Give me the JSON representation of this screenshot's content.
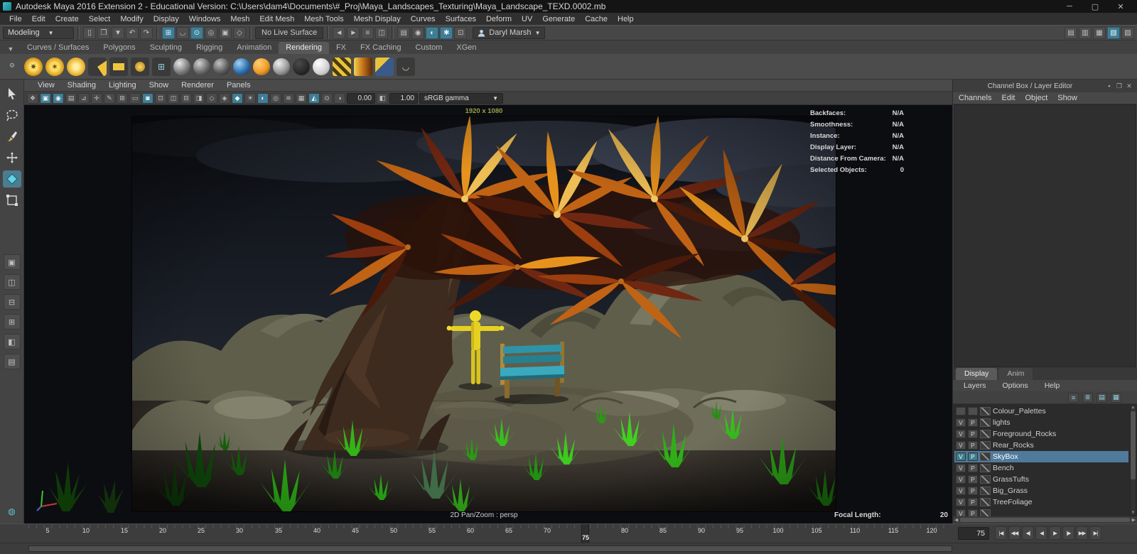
{
  "window": {
    "title": "Autodesk Maya 2016 Extension 2 - Educational Version: C:\\Users\\dam4\\Documents\\#_Proj\\Maya_Landscapes_Texturing\\Maya_Landscape_TEXD.0002.mb"
  },
  "menubar": {
    "items": [
      "File",
      "Edit",
      "Create",
      "Select",
      "Modify",
      "Display",
      "Windows",
      "Mesh",
      "Edit Mesh",
      "Mesh Tools",
      "Mesh Display",
      "Curves",
      "Surfaces",
      "Deform",
      "UV",
      "Generate",
      "Cache",
      "Help"
    ]
  },
  "statusline": {
    "mode": "Modeling",
    "live_surface": "No Live Surface",
    "user": "Daryl Marsh"
  },
  "shelf": {
    "tabs": [
      "Curves / Surfaces",
      "Polygons",
      "Sculpting",
      "Rigging",
      "Animation",
      "Rendering",
      "FX",
      "FX Caching",
      "Custom",
      "XGen"
    ],
    "active_tab": "Rendering"
  },
  "panel_menu": {
    "items": [
      "View",
      "Shading",
      "Lighting",
      "Show",
      "Renderer",
      "Panels"
    ]
  },
  "vp_toolbar": {
    "exposure": "0.00",
    "gamma": "1.00",
    "view_transform": "sRGB gamma"
  },
  "viewport": {
    "resolution": "1920 x 1080",
    "pan_zoom": "2D Pan/Zoom : persp",
    "focal_length_label": "Focal Length:",
    "focal_length_value": "20",
    "hud": [
      {
        "label": "Backfaces:",
        "value": "N/A"
      },
      {
        "label": "Smoothness:",
        "value": "N/A"
      },
      {
        "label": "Instance:",
        "value": "N/A"
      },
      {
        "label": "Display Layer:",
        "value": "N/A"
      },
      {
        "label": "Distance From Camera:",
        "value": "N/A"
      },
      {
        "label": "Selected Objects:",
        "value": "0"
      }
    ]
  },
  "channel_box": {
    "title": "Channel Box / Layer Editor",
    "menus": [
      "Channels",
      "Edit",
      "Object",
      "Show"
    ],
    "tabs": [
      "Display",
      "Anim"
    ],
    "active_tab": "Display",
    "layer_menus": [
      "Layers",
      "Options",
      "Help"
    ],
    "layers": [
      {
        "v": "",
        "p": "",
        "name": "Colour_Palettes",
        "selected": false
      },
      {
        "v": "V",
        "p": "P",
        "name": "lights",
        "selected": false
      },
      {
        "v": "V",
        "p": "P",
        "name": "Foreground_Rocks",
        "selected": false
      },
      {
        "v": "V",
        "p": "P",
        "name": "Rear_Rocks",
        "selected": false
      },
      {
        "v": "V",
        "p": "P",
        "name": "SkyBox",
        "selected": true
      },
      {
        "v": "V",
        "p": "P",
        "name": "Bench",
        "selected": false
      },
      {
        "v": "V",
        "p": "P",
        "name": "GrassTufts",
        "selected": false
      },
      {
        "v": "V",
        "p": "P",
        "name": "Big_Grass",
        "selected": false
      },
      {
        "v": "V",
        "p": "P",
        "name": "TreeFoliage",
        "selected": false
      },
      {
        "v": "V",
        "p": "P",
        "name": "",
        "selected": false
      }
    ]
  },
  "timeline": {
    "ticks": [
      "5",
      "10",
      "15",
      "20",
      "25",
      "30",
      "35",
      "40",
      "45",
      "50",
      "55",
      "60",
      "65",
      "70",
      "75",
      "80",
      "85",
      "90",
      "95",
      "100",
      "105",
      "110",
      "115",
      "120"
    ],
    "current_frame": "75",
    "frame_field": "75",
    "playback_icons": [
      "|◀",
      "◀◀",
      "◀|",
      "◀",
      "▶",
      "|▶",
      "▶▶",
      "▶|"
    ]
  },
  "colors": {
    "selection_highlight": "#507a9b",
    "accent_teal": "#3f7d95",
    "foliage_orange": "#e8921e",
    "grass_green": "#2fae18",
    "bench_teal": "#3aa9bd",
    "mannequin_yellow": "#e6d122"
  }
}
